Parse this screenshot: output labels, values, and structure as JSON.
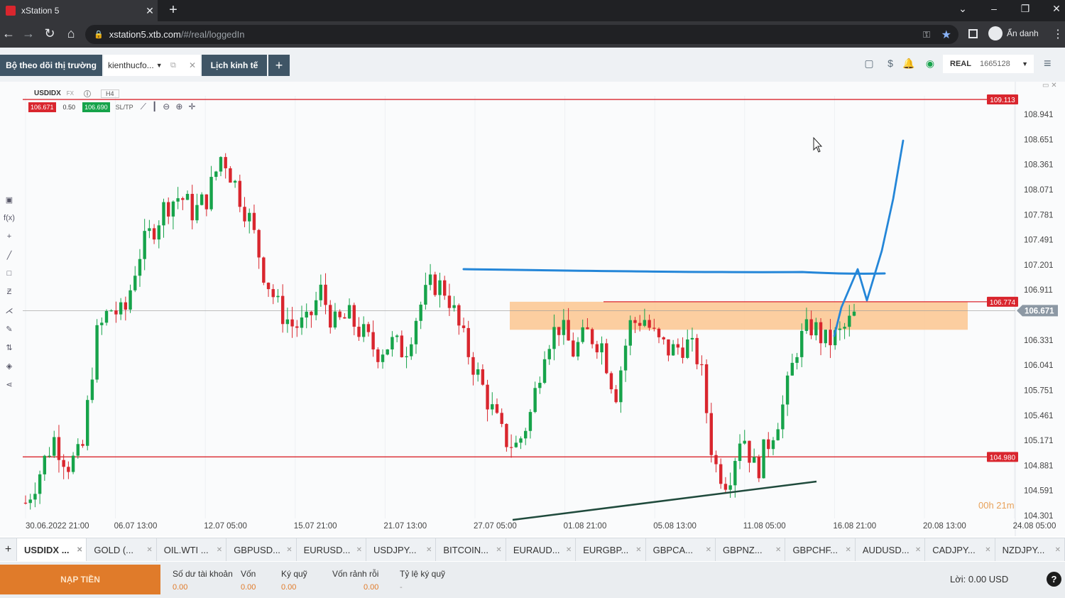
{
  "browser": {
    "tab_title": "xStation 5",
    "url_host": "xstation5.xtb.com",
    "url_path": "/#/real/loggedIn",
    "profile_label": "Ẩn danh"
  },
  "app": {
    "tabs": [
      "Bộ theo dõi thị trường",
      "kienthucfo...",
      "Lịch kinh tế"
    ],
    "account": {
      "mode": "REAL",
      "number": "1665128"
    }
  },
  "chart": {
    "symbol": "USDIDX",
    "category": "FX",
    "timeframe": "H4",
    "sell_price": "106.671",
    "volume": "0.50",
    "buy_price": "106.690",
    "sltp_label": "SL/TP",
    "countdown": "00h 21m",
    "price_labels": [
      "108.941",
      "108.651",
      "108.361",
      "108.071",
      "107.781",
      "107.491",
      "107.201",
      "106.911",
      "106.331",
      "106.041",
      "105.751",
      "105.461",
      "105.171",
      "104.881",
      "104.591",
      "104.301"
    ],
    "level_labels": {
      "top": "109.113",
      "zone": "106.774",
      "current": "106.671",
      "bottom": "104.980"
    },
    "x_labels": [
      "30.06.2022 21:00",
      "06.07 13:00",
      "12.07 05:00",
      "15.07 21:00",
      "21.07 13:00",
      "27.07 05:00",
      "01.08 21:00",
      "05.08 13:00",
      "11.08 05:00",
      "16.08 21:00",
      "20.08 13:00",
      "24.08 05:00"
    ]
  },
  "chart_data": {
    "type": "candlestick",
    "symbol": "USDIDX",
    "timeframe": "H4",
    "x_axis": [
      "30.06.2022 21:00",
      "06.07 13:00",
      "12.07 05:00",
      "15.07 21:00",
      "21.07 13:00",
      "27.07 05:00",
      "01.08 21:00",
      "05.08 13:00",
      "11.08 05:00",
      "16.08 21:00",
      "20.08 13:00",
      "24.08 05:00"
    ],
    "y_axis": [
      108.941,
      108.651,
      108.361,
      108.071,
      107.781,
      107.491,
      107.201,
      106.911,
      106.331,
      106.041,
      105.751,
      105.461,
      105.171,
      104.881,
      104.591,
      104.301
    ],
    "price_path": [
      104.45,
      104.8,
      105.2,
      104.9,
      105.0,
      106.35,
      106.7,
      106.6,
      107.3,
      107.6,
      107.9,
      108.0,
      107.8,
      108.0,
      108.5,
      108.1,
      107.7,
      107.1,
      106.7,
      106.5,
      106.5,
      106.9,
      106.5,
      106.6,
      106.4,
      106.2,
      106.3,
      106.2,
      106.7,
      107.0,
      106.9,
      106.4,
      106.0,
      105.6,
      105.2,
      105.1,
      105.5,
      106.3,
      106.5,
      106.2,
      106.4,
      106.3,
      105.7,
      106.5,
      106.6,
      106.3,
      106.2,
      106.3,
      106.1,
      104.9,
      104.7,
      105.3,
      104.8,
      105.2,
      105.6,
      106.3,
      106.5,
      106.3,
      106.4,
      106.6
    ],
    "horizontal_levels": [
      109.113,
      106.774,
      106.671,
      104.98
    ],
    "current_bid": 106.671,
    "current_ask": 106.69
  },
  "instruments": [
    "USDIDX ...",
    "GOLD (...",
    "OIL.WTI ...",
    "GBPUSD...",
    "EURUSD...",
    "USDJPY...",
    "BITCOIN...",
    "EURAUD...",
    "EURGBP...",
    "GBPCA...",
    "GBPNZ...",
    "GBPCHF...",
    "AUDUSD...",
    "CADJPY...",
    "NZDJPY..."
  ],
  "footer": {
    "deposit": "NẠP TIỀN",
    "stats": [
      {
        "label": "Số dư tài khoản",
        "value": "0.00"
      },
      {
        "label": "Vốn",
        "value": "0.00"
      },
      {
        "label": "Ký quỹ",
        "value": "0.00"
      },
      {
        "label": "Vốn rảnh rỗi",
        "value": "0.00"
      },
      {
        "label": "Tỷ lệ ký quỹ",
        "value": "-"
      }
    ],
    "profit": "Lời: 0.00 USD"
  },
  "colors": {
    "up": "#16a34a",
    "down": "#d9262e",
    "level": "#d9262e",
    "zone": "#fbc58f",
    "drawing": "#2486d8",
    "trendline": "#1f4a3c",
    "accent": "#e07b2a"
  }
}
